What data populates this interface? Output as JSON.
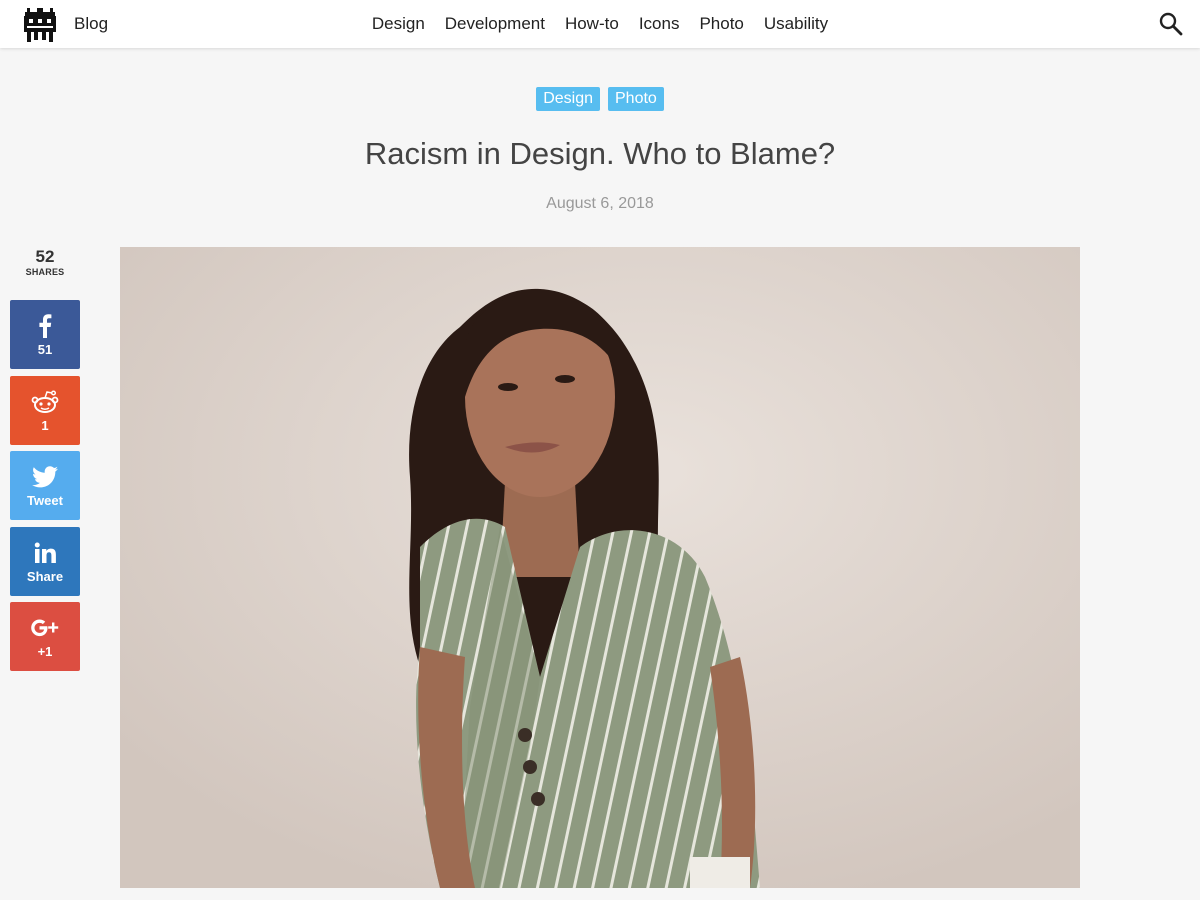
{
  "header": {
    "blog_label": "Blog",
    "nav": [
      "Design",
      "Development",
      "How-to",
      "Icons",
      "Photo",
      "Usability"
    ]
  },
  "article": {
    "tags": [
      "Design",
      "Photo"
    ],
    "title": "Racism in Design. Who to Blame?",
    "date": "August 6, 2018"
  },
  "share": {
    "total": "52",
    "total_label": "SHARES",
    "buttons": [
      {
        "network": "facebook",
        "label": "51",
        "icon": "facebook-icon",
        "color": "#3b5998"
      },
      {
        "network": "reddit",
        "label": "1",
        "icon": "reddit-icon",
        "color": "#e5532d"
      },
      {
        "network": "twitter",
        "label": "Tweet",
        "icon": "twitter-icon",
        "color": "#55acee"
      },
      {
        "network": "linkedin",
        "label": "Share",
        "icon": "linkedin-icon",
        "color": "#2e77bc"
      },
      {
        "network": "google-plus",
        "label": "+1",
        "icon": "google-plus-icon",
        "color": "#dc4e41"
      }
    ]
  },
  "colors": {
    "tag": "#57bdf0",
    "background": "#f6f6f6"
  }
}
